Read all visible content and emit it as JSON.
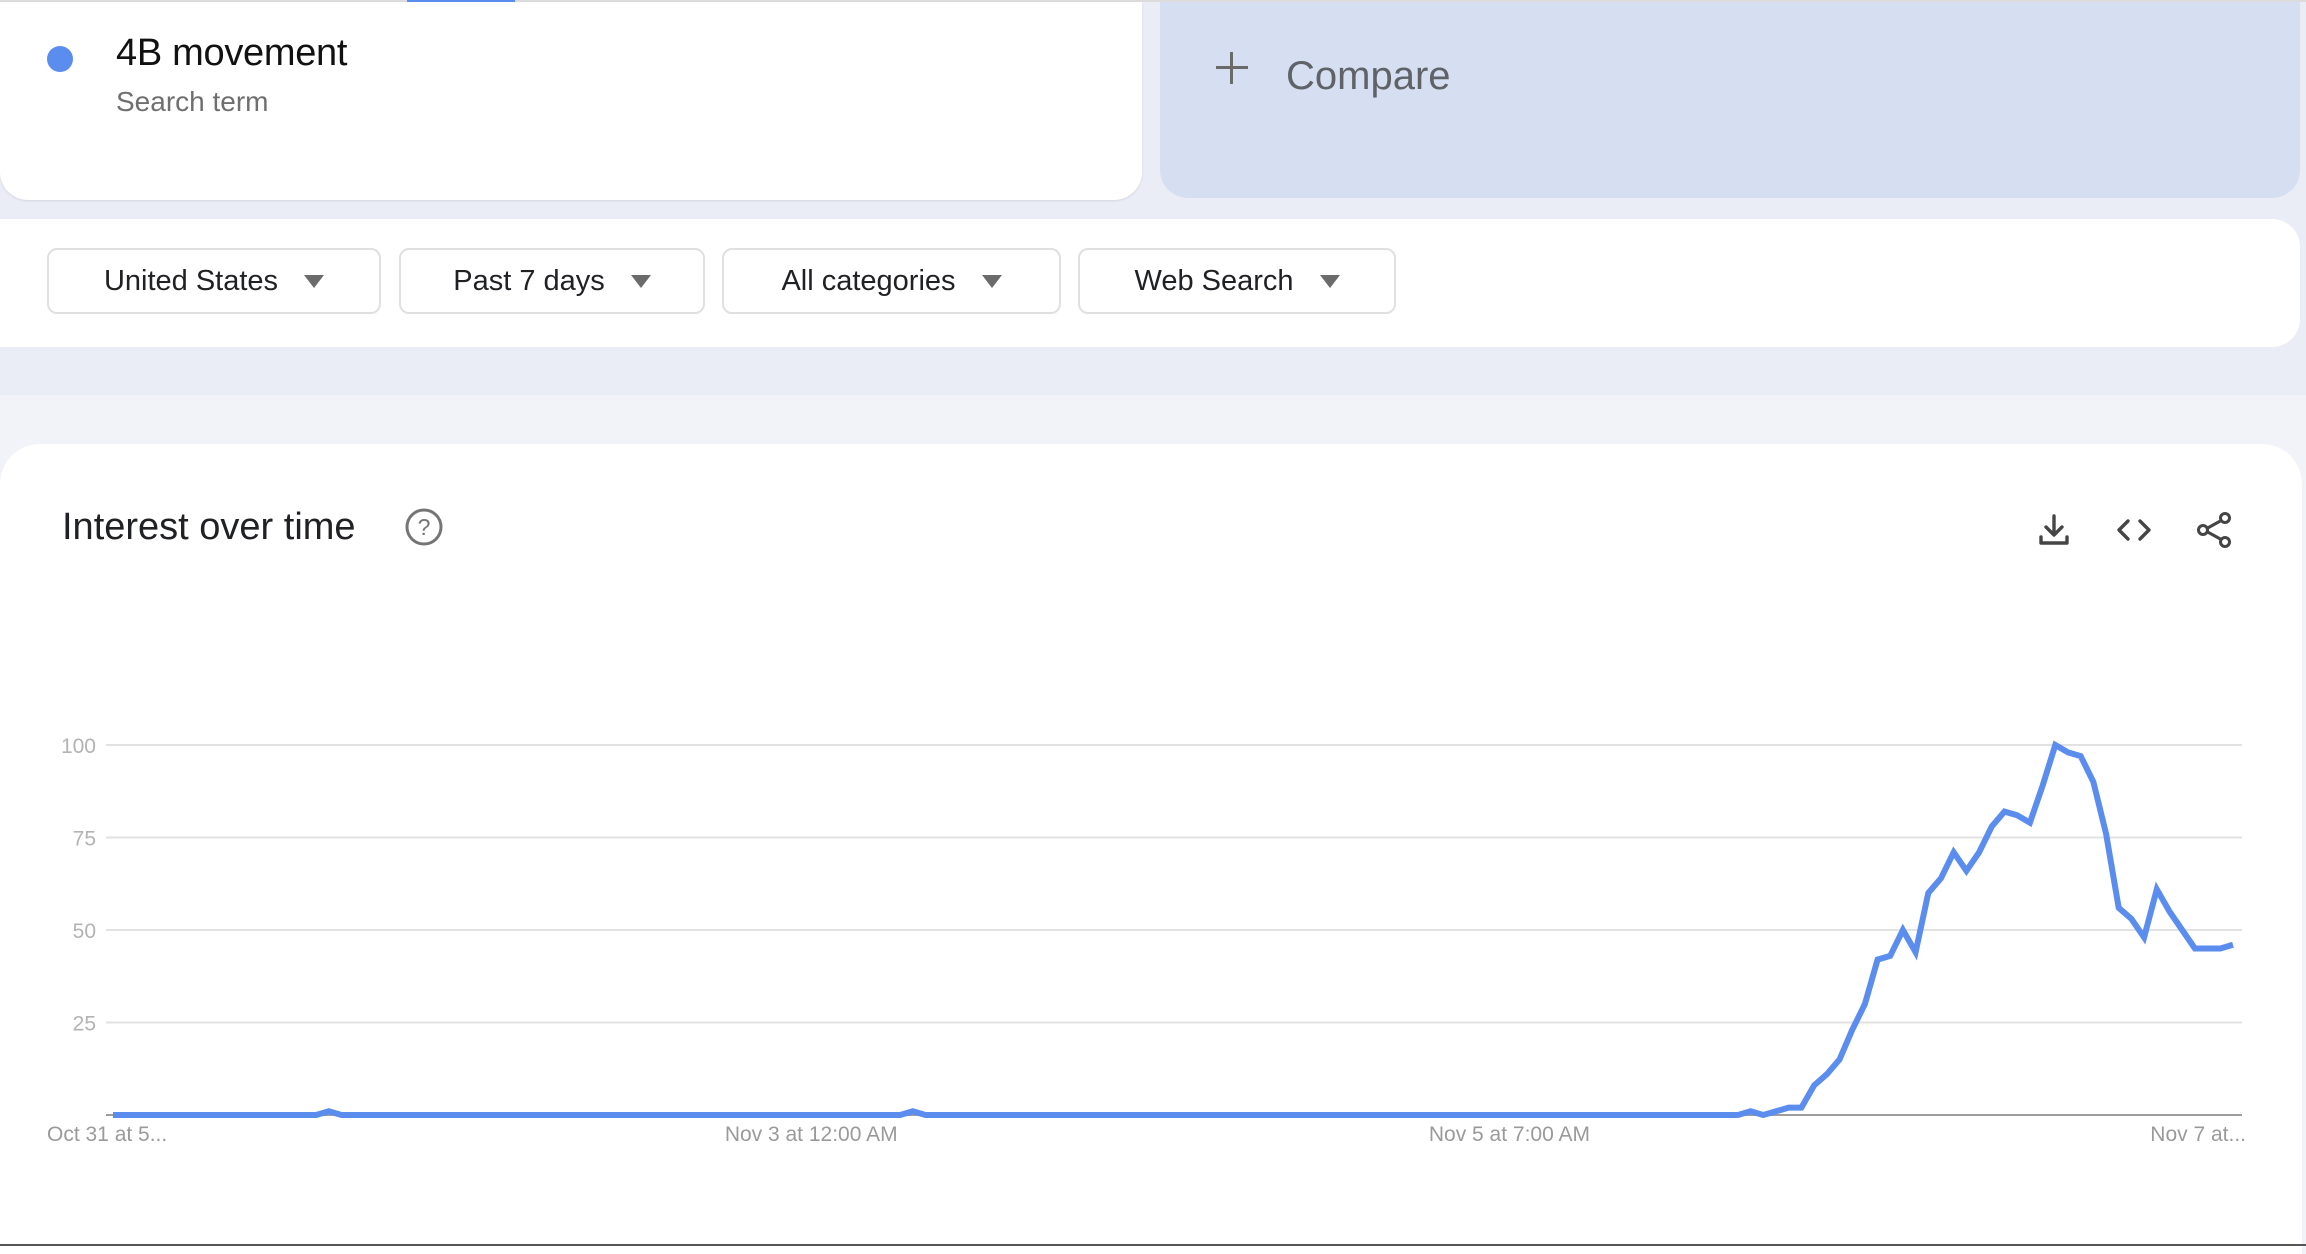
{
  "search_term": {
    "name": "4B movement",
    "subtitle": "Search term",
    "color": "#5b8def"
  },
  "compare": {
    "label": "Compare",
    "icon": "plus-icon"
  },
  "filters": [
    {
      "label": "United States",
      "icon": "dropdown-caret-icon"
    },
    {
      "label": "Past 7 days",
      "icon": "dropdown-caret-icon"
    },
    {
      "label": "All categories",
      "icon": "dropdown-caret-icon"
    },
    {
      "label": "Web Search",
      "icon": "dropdown-caret-icon"
    }
  ],
  "panel": {
    "title": "Interest over time",
    "help_icon": "help-circle-icon",
    "actions": [
      "download-icon",
      "embed-code-icon",
      "share-icon"
    ]
  },
  "chart_data": {
    "type": "line",
    "title": "Interest over time",
    "xlabel": "",
    "ylabel": "",
    "ylim": [
      0,
      100
    ],
    "yticks": [
      25,
      50,
      75,
      100
    ],
    "grid": true,
    "legend": "none",
    "x_tick_labels": [
      {
        "index": 0,
        "label": "Oct 31 at 5..."
      },
      {
        "index": 55,
        "label": "Nov 3 at 12:00 AM"
      },
      {
        "index": 110,
        "label": "Nov 5 at 7:00 AM"
      },
      {
        "index": 164,
        "label": "Nov 7 at..."
      }
    ],
    "series": [
      {
        "name": "4B movement",
        "color": "#5b8def",
        "values": [
          0,
          0,
          0,
          0,
          0,
          0,
          0,
          0,
          0,
          0,
          0,
          0,
          0,
          0,
          0,
          0,
          0,
          1,
          0,
          0,
          0,
          0,
          0,
          0,
          0,
          0,
          0,
          0,
          0,
          0,
          0,
          0,
          0,
          0,
          0,
          0,
          0,
          0,
          0,
          0,
          0,
          0,
          0,
          0,
          0,
          0,
          0,
          0,
          0,
          0,
          0,
          0,
          0,
          0,
          0,
          0,
          0,
          0,
          0,
          0,
          0,
          0,
          0,
          1,
          0,
          0,
          0,
          0,
          0,
          0,
          0,
          0,
          0,
          0,
          0,
          0,
          0,
          0,
          0,
          0,
          0,
          0,
          0,
          0,
          0,
          0,
          0,
          0,
          0,
          0,
          0,
          0,
          0,
          0,
          0,
          0,
          0,
          0,
          0,
          0,
          0,
          0,
          0,
          0,
          0,
          0,
          0,
          0,
          0,
          0,
          0,
          0,
          0,
          0,
          0,
          0,
          0,
          0,
          0,
          0,
          0,
          0,
          0,
          0,
          0,
          0,
          0,
          0,
          0,
          1,
          0,
          1,
          2,
          2,
          8,
          11,
          15,
          23,
          30,
          42,
          43,
          50,
          44,
          60,
          64,
          71,
          66,
          71,
          78,
          82,
          81,
          79,
          89,
          100,
          98,
          97,
          90,
          76,
          56,
          53,
          48,
          61,
          55,
          50,
          45,
          45,
          45,
          46
        ]
      }
    ]
  }
}
